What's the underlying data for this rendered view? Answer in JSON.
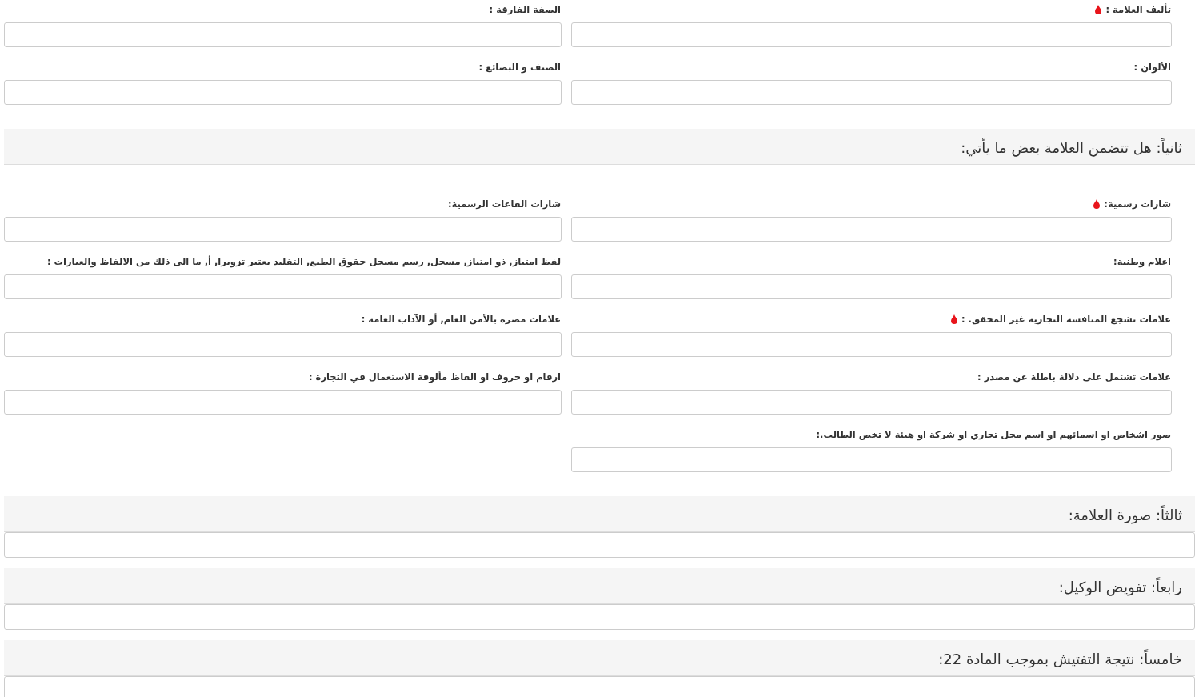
{
  "sections": [
    {
      "kind": "grid",
      "fields": [
        {
          "label": "تأليف العلامة :",
          "required": true
        },
        {
          "label": "الصفة الفارقة :",
          "required": false
        },
        {
          "label": "الألوان :",
          "required": false
        },
        {
          "label": "الصنف و البضائع :",
          "required": false
        }
      ]
    },
    {
      "kind": "grid",
      "title": "ثانياً: هل تتضمن العلامة بعض ما يأتي:",
      "fields": [
        {
          "label": "شارات رسمية:",
          "required": true
        },
        {
          "label": "شارات القاعات الرسمية:",
          "required": false
        },
        {
          "label": "اعلام وطنية:",
          "required": false
        },
        {
          "label": "لفظ امتياز, ذو امتياز, مسجل, رسم مسجل حقوق الطبع, التقليد يعتبر تزويرا, أ, ما الى ذلك من الالفاظ والعبارات :",
          "required": false
        },
        {
          "label": "علامات تشجع المنافسة التجارية غير المحقق. :",
          "required": true
        },
        {
          "label": "علامات مضرة بالأمن العام, أو الآداب العامة :",
          "required": false
        },
        {
          "label": "علامات تشتمل على دلالة باطلة عن مصدر :",
          "required": false
        },
        {
          "label": "ارقام او حروف او الفاظ مألوفة الاستعمال في التجارة :",
          "required": false
        },
        {
          "label": "صور اشخاص او اسمائهم او اسم محل تجاري او شركة او هيئة لا تخص الطالب.:",
          "required": false
        }
      ]
    },
    {
      "kind": "panel",
      "title": "ثالثاً: صورة العلامة:"
    },
    {
      "kind": "panel",
      "title": "رابعاً: تفويض الوكيل:"
    },
    {
      "kind": "panel",
      "title": "خامساً: نتيجة التفتيش بموجب المادة 22:"
    }
  ]
}
